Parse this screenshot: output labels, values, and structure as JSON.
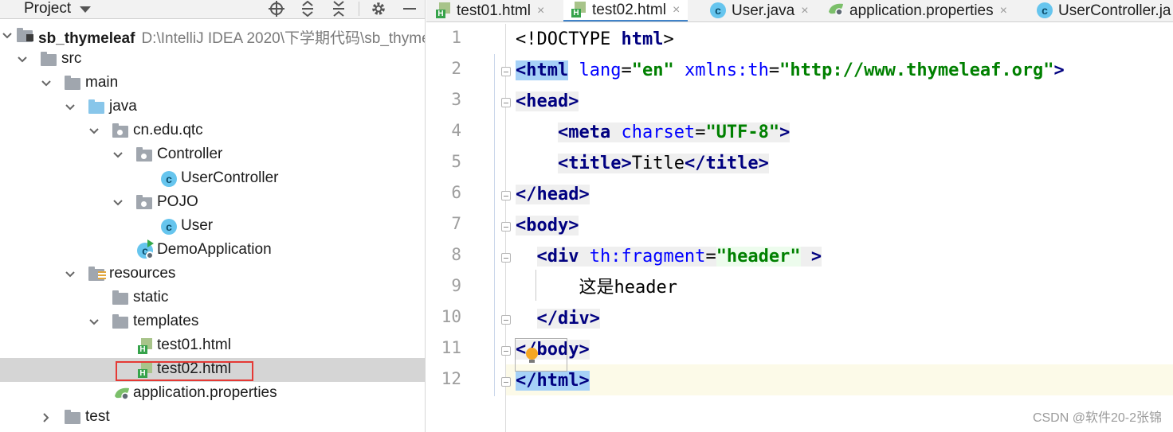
{
  "project_panel": {
    "title": "Project",
    "tree": [
      {
        "label": "sb_thymeleaf",
        "path": "D:\\IntelliJ IDEA 2020\\下学期代码\\sb_thyme",
        "icon": "module-folder-icon"
      },
      {
        "label": "src",
        "icon": "folder-icon"
      },
      {
        "label": "main",
        "icon": "folder-icon"
      },
      {
        "label": "java",
        "icon": "source-folder-icon"
      },
      {
        "label": "cn.edu.qtc",
        "icon": "package-icon"
      },
      {
        "label": "Controller",
        "icon": "package-icon"
      },
      {
        "label": "UserController",
        "icon": "class-icon"
      },
      {
        "label": "POJO",
        "icon": "package-icon"
      },
      {
        "label": "User",
        "icon": "class-icon"
      },
      {
        "label": "DemoApplication",
        "icon": "spring-boot-class-icon"
      },
      {
        "label": "resources",
        "icon": "resources-folder-icon"
      },
      {
        "label": "static",
        "icon": "folder-icon"
      },
      {
        "label": "templates",
        "icon": "folder-icon"
      },
      {
        "label": "test01.html",
        "icon": "html-file-icon"
      },
      {
        "label": "test02.html",
        "icon": "html-file-icon",
        "selected": true
      },
      {
        "label": "application.properties",
        "icon": "properties-file-icon"
      },
      {
        "label": "test",
        "icon": "folder-icon"
      }
    ]
  },
  "editor": {
    "tabs": [
      {
        "label": "test01.html",
        "icon": "html-file-icon",
        "close": "×"
      },
      {
        "label": "test02.html",
        "icon": "html-file-icon",
        "close": "×",
        "active": true
      },
      {
        "label": "User.java",
        "icon": "class-icon",
        "close": "×"
      },
      {
        "label": "application.properties",
        "icon": "properties-file-icon",
        "close": "×"
      },
      {
        "label": "UserController.ja",
        "icon": "class-icon",
        "close": ""
      }
    ],
    "line_numbers": [
      "1",
      "2",
      "3",
      "4",
      "5",
      "6",
      "7",
      "8",
      "9",
      "10",
      "11",
      "12"
    ],
    "code": {
      "l1": {
        "a": "<!DOCTYPE ",
        "b": "html",
        "c": ">"
      },
      "l2": {
        "t1": "<html",
        "a1": " lang",
        "eq1": "=",
        "v1": "\"en\"",
        "a2": " xmlns:th",
        "eq2": "=",
        "v2": "\"http://www.thymeleaf.org\"",
        "end": ">"
      },
      "l3": {
        "t": "<head",
        "end": ">"
      },
      "l4": {
        "indent": "    ",
        "t": "<meta",
        "a": " charset",
        "eq": "=",
        "v": "\"UTF-8\"",
        "end": ">"
      },
      "l5": {
        "indent": "    ",
        "t1": "<title",
        "gt": ">",
        "text": "Title",
        "t2": "</title",
        "end": ">"
      },
      "l6": {
        "t": "</head",
        "end": ">"
      },
      "l7": {
        "t": "<body",
        "end": ">"
      },
      "l8": {
        "indent": "  ",
        "t": "<div",
        "a": " th:fragment",
        "eq": "=",
        "v": "\"header\"",
        "end": " >"
      },
      "l9": {
        "indent": "      ",
        "text": "这是header"
      },
      "l10": {
        "indent": "  ",
        "t": "</div",
        "end": ">"
      },
      "l11": {
        "t": "</body",
        "end": ">"
      },
      "l12": {
        "t": "</html",
        "end": ">"
      }
    }
  },
  "watermark": "CSDN @软件20-2张锦"
}
